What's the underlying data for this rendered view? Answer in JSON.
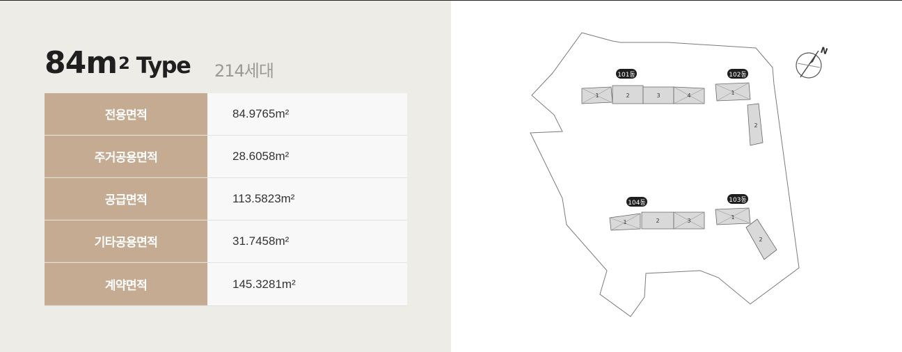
{
  "unit_type": {
    "size": "84m",
    "superscript": "2",
    "type_word": "Type",
    "households": "214세대"
  },
  "area_table": {
    "rows": [
      {
        "label": "전용면적",
        "value": "84.9765m²"
      },
      {
        "label": "주거공용면적",
        "value": "28.6058m²"
      },
      {
        "label": "공급면적",
        "value": "113.5823m²"
      },
      {
        "label": "기타공용면적",
        "value": "31.7458m²"
      },
      {
        "label": "계약면적",
        "value": "145.3281m²"
      }
    ]
  },
  "site_plan": {
    "compass_label": "N",
    "buildings": [
      {
        "tag": "101동",
        "units": [
          "1",
          "2",
          "3",
          "4"
        ]
      },
      {
        "tag": "102동",
        "units": [
          "1",
          "2"
        ]
      },
      {
        "tag": "103동",
        "units": [
          "1",
          "2"
        ]
      },
      {
        "tag": "104동",
        "units": [
          "1",
          "2",
          "3"
        ]
      }
    ]
  },
  "colors": {
    "left_background": "#edece7",
    "label_cell": "#c4ab91",
    "value_cell": "#f8f8f8",
    "tag_badge": "#1e1e1e"
  }
}
